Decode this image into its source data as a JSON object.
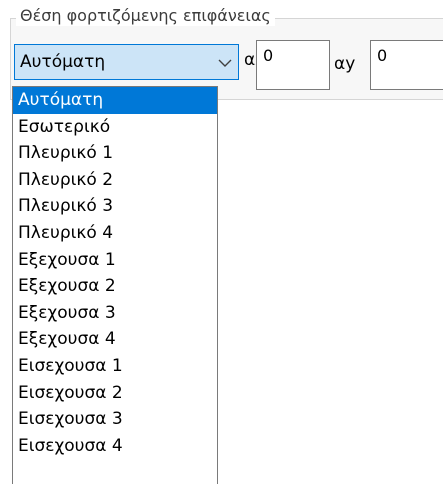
{
  "group": {
    "title": "Θέση φορτιζόμενης επιφάνειας"
  },
  "position_select": {
    "value": "Αυτόματη",
    "options": [
      "Αυτόματη",
      "Εσωτερικό",
      "Πλευρικό 1",
      "Πλευρικό 2",
      "Πλευρικό 3",
      "Πλευρικό 4",
      "Εξεχουσα 1",
      "Εξεχουσα 2",
      "Εξεχουσα 3",
      "Εξεχουσα 4",
      "Εισεχουσα 1",
      "Εισεχουσα 2",
      "Εισεχουσα 3",
      "Εισεχουσα 4"
    ],
    "selected_index": 0
  },
  "ax": {
    "label": "αx",
    "value": "0"
  },
  "ay": {
    "label": "αy",
    "value": "0"
  },
  "colors": {
    "accent": "#0078d7",
    "combo_bg": "#cce4f7",
    "group_bg": "#f7f7f7"
  },
  "icons": {
    "combo_arrow": "chevron-down-icon"
  }
}
